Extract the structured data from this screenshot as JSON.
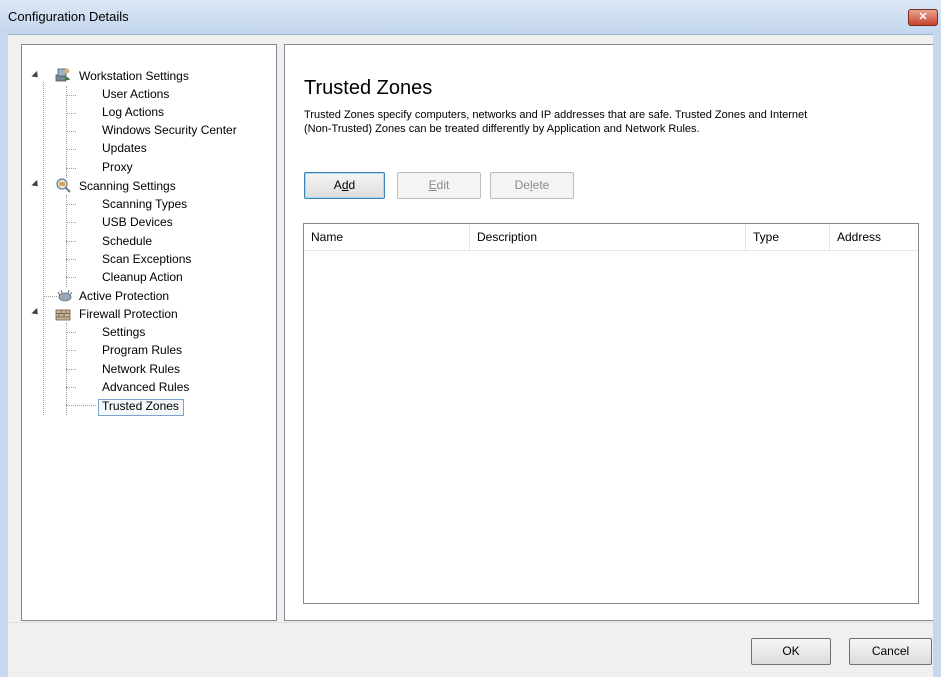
{
  "window": {
    "title": "Configuration Details",
    "close_icon": "close-icon"
  },
  "tree": {
    "groups": [
      {
        "label": "Workstation Settings",
        "icon": "workstation-settings-icon",
        "children": [
          "User Actions",
          "Log Actions",
          "Windows Security Center",
          "Updates",
          "Proxy"
        ]
      },
      {
        "label": "Scanning Settings",
        "icon": "scanning-settings-icon",
        "children": [
          "Scanning Types",
          "USB Devices",
          "Schedule",
          "Scan Exceptions",
          "Cleanup Action"
        ]
      },
      {
        "label": "Active Protection",
        "icon": "active-protection-icon",
        "children": []
      },
      {
        "label": "Firewall Protection",
        "icon": "firewall-protection-icon",
        "children": [
          "Settings",
          "Program Rules",
          "Network Rules",
          "Advanced Rules",
          "Trusted Zones"
        ]
      }
    ],
    "selected": "Trusted Zones"
  },
  "main": {
    "heading": "Trusted Zones",
    "description_line1": "Trusted Zones specify computers, networks and IP addresses that are safe. Trusted Zones and Internet",
    "description_line2": "(Non-Trusted) Zones can be treated differently by Application and Network Rules.",
    "buttons": {
      "add": {
        "pre": "A",
        "key": "d",
        "post": "d",
        "enabled": true
      },
      "edit": {
        "pre": "",
        "key": "E",
        "post": "dit",
        "enabled": false
      },
      "delete": {
        "pre": "De",
        "key": "l",
        "post": "ete",
        "enabled": false
      }
    },
    "table": {
      "columns": [
        "Name",
        "Description",
        "Type",
        "Address"
      ],
      "rows": []
    }
  },
  "footer": {
    "ok_label": "OK",
    "cancel_label": "Cancel"
  }
}
